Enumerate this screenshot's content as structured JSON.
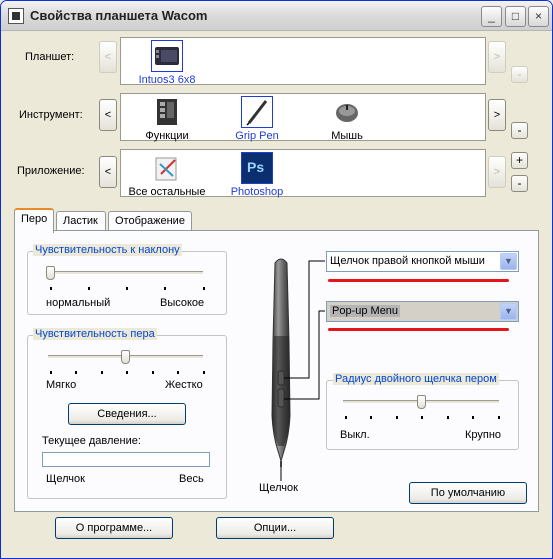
{
  "window": {
    "title": "Свойства планшета Wacom",
    "minimize": "_",
    "maximize": "□",
    "close": "×"
  },
  "rows": {
    "tablet": {
      "label": "Планшет:",
      "items": [
        {
          "label": "Intuos3 6x8",
          "icon": "tablet-icon",
          "selected": true
        }
      ]
    },
    "tool": {
      "label": "Инструмент:",
      "items": [
        {
          "label": "Функции",
          "icon": "functions-icon"
        },
        {
          "label": "Grip Pen",
          "icon": "pen-icon",
          "selected": true
        },
        {
          "label": "Мышь",
          "icon": "mouse-icon"
        }
      ]
    },
    "app": {
      "label": "Приложение:",
      "items": [
        {
          "label": "Все остальные",
          "icon": "all-apps-icon"
        },
        {
          "label": "Photoshop",
          "icon": "photoshop-icon",
          "selected": true,
          "icon_text": "Ps"
        }
      ]
    }
  },
  "nav": {
    "prev": "<",
    "next": ">",
    "plus": "+",
    "minus": "-"
  },
  "tabs": [
    {
      "label": "Перо",
      "active": true
    },
    {
      "label": "Ластик"
    },
    {
      "label": "Отображение"
    }
  ],
  "pen_tab": {
    "tilt": {
      "title": "Чувствительность к наклону",
      "min_label": "нормальный",
      "max_label": "Высокое",
      "value": 0
    },
    "tip": {
      "title": "Чувствительность пера",
      "min_label": "Мягко",
      "max_label": "Жестко",
      "value": 0.5,
      "details_button": "Сведения...",
      "pressure_label": "Текущее давление:",
      "pressure_min": "Щелчок",
      "pressure_max": "Весь"
    },
    "pen_label": "Щелчок",
    "upper_button": "Щелчок правой кнопкой мыши",
    "lower_button": "Pop-up Menu",
    "double_click": {
      "title": "Радиус двойного щелчка пером",
      "min_label": "Выкл.",
      "max_label": "Крупно",
      "value": 0.5
    },
    "default_button": "По умолчанию"
  },
  "footer": {
    "about_button": "О программе...",
    "options_button": "Опции..."
  },
  "colors": {
    "accent": "#1f3cd8",
    "legend": "#0046d5",
    "highlight": "#e4141b",
    "tab_accent": "#e68b2c"
  }
}
